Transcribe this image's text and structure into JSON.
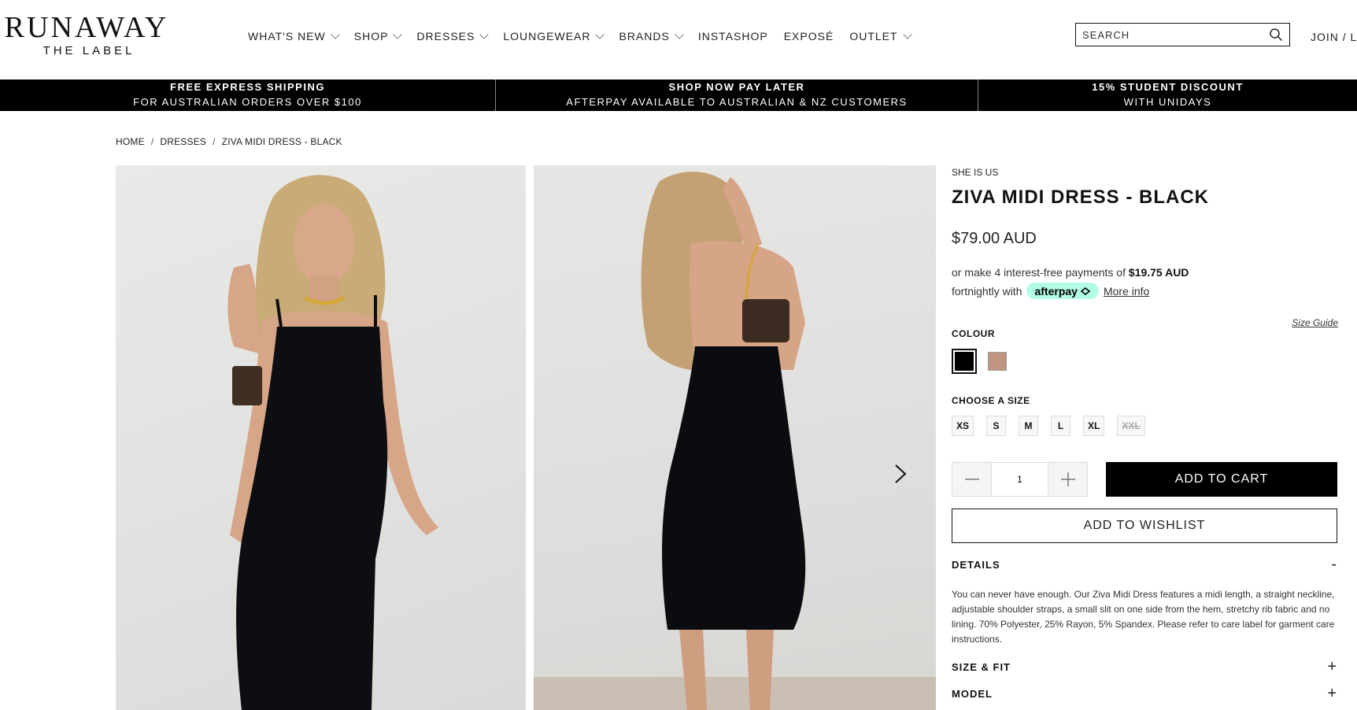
{
  "header": {
    "logo_main": "RUNAWAY",
    "logo_sub": "THE LABEL",
    "nav": [
      {
        "label": "WHAT'S NEW",
        "dropdown": true
      },
      {
        "label": "SHOP",
        "dropdown": true
      },
      {
        "label": "DRESSES",
        "dropdown": true
      },
      {
        "label": "LOUNGEWEAR",
        "dropdown": true
      },
      {
        "label": "BRANDS",
        "dropdown": true
      },
      {
        "label": "INSTASHOP",
        "dropdown": false
      },
      {
        "label": "EXPOSÉ",
        "dropdown": false
      },
      {
        "label": "OUTLET",
        "dropdown": true
      }
    ],
    "search_placeholder": "SEARCH",
    "join": "JOIN / LO"
  },
  "promo": [
    {
      "title": "FREE EXPRESS SHIPPING",
      "sub": "FOR AUSTRALIAN ORDERS OVER $100"
    },
    {
      "title": "SHOP NOW PAY LATER",
      "sub": "AFTERPAY AVAILABLE TO AUSTRALIAN & NZ CUSTOMERS"
    },
    {
      "title": "15% STUDENT DISCOUNT",
      "sub": "WITH UNIDAYS"
    }
  ],
  "breadcrumb": {
    "home": "HOME",
    "sep": "/",
    "category": "DRESSES",
    "current": "ZIVA MIDI DRESS - BLACK"
  },
  "product": {
    "brand": "SHE IS US",
    "title": "ZIVA MIDI DRESS - BLACK",
    "price": "$79.00 AUD",
    "afterpay_pre": "or make 4 interest-free payments of",
    "afterpay_amount": "$19.75 AUD",
    "afterpay_post": "fortnightly with",
    "afterpay_badge": "afterpay",
    "more_info": "More info",
    "colour_label": "COLOUR",
    "size_guide": "Size Guide",
    "colours": [
      {
        "name": "black",
        "hex": "#000000"
      },
      {
        "name": "tan",
        "hex": "#c09480"
      }
    ],
    "size_label": "CHOOSE A SIZE",
    "sizes": [
      {
        "label": "XS",
        "available": true
      },
      {
        "label": "S",
        "available": true
      },
      {
        "label": "M",
        "available": true
      },
      {
        "label": "L",
        "available": true
      },
      {
        "label": "XL",
        "available": true
      },
      {
        "label": "XXL",
        "available": false
      }
    ],
    "quantity": "1",
    "add_to_cart": "ADD TO CART",
    "add_to_wishlist": "ADD TO WISHLIST",
    "details_title": "DETAILS",
    "details_toggle": "-",
    "details_text": "You can never have enough. Our Ziva Midi Dress features a midi length, a straight neckline, adjustable shoulder straps, a small slit on one side from the hem, stretchy rib fabric and no lining. 70% Polyester, 25% Rayon, 5% Spandex. Please refer to care label for garment care instructions.",
    "size_fit_title": "SIZE & FIT",
    "model_title": "MODEL",
    "collapsed_toggle": "+"
  },
  "colors": {
    "accent": "#000000",
    "afterpay": "#b2fce4",
    "promo_bg": "#000000"
  }
}
